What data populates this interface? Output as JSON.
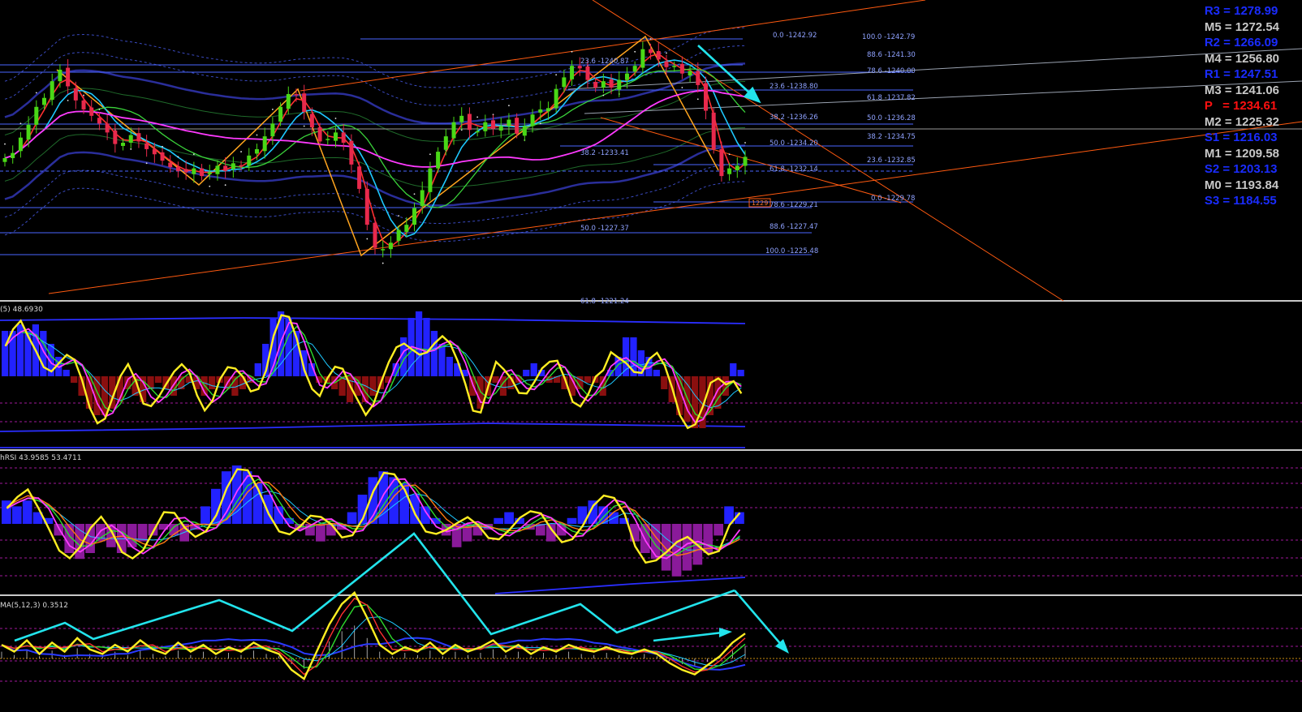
{
  "panes": [
    {
      "id": "price",
      "label": ""
    },
    {
      "id": "osc1",
      "label": "(5) 48.6930"
    },
    {
      "id": "osc2",
      "label": "hRSI 43.9585 53.4711"
    },
    {
      "id": "osc3",
      "label": "MA(5,12,3) 0.3512"
    }
  ],
  "pivots": [
    {
      "text": "R3 = 1278.99",
      "color": "#1a2cff"
    },
    {
      "text": "M5 = 1272.54",
      "color": "#c8c8c8"
    },
    {
      "text": "R2 = 1266.09",
      "color": "#1a2cff"
    },
    {
      "text": "M4 = 1256.80",
      "color": "#c8c8c8"
    },
    {
      "text": "R1 = 1247.51",
      "color": "#1a2cff"
    },
    {
      "text": "M3 = 1241.06",
      "color": "#c8c8c8"
    },
    {
      "text": "P   = 1234.61",
      "color": "#ff1010"
    },
    {
      "text": "M2 = 1225.32",
      "color": "#c8c8c8"
    },
    {
      "text": "S1 = 1216.03",
      "color": "#1a2cff"
    },
    {
      "text": "M1 = 1209.58",
      "color": "#c8c8c8"
    },
    {
      "text": "S2 = 1203.13",
      "color": "#1a2cff"
    },
    {
      "text": "M0 = 1193.84",
      "color": "#c8c8c8"
    },
    {
      "text": "S3 = 1184.55",
      "color": "#1a2cff"
    }
  ],
  "fib_labels": [
    "0.0 -1242.92",
    "100.0 -1242.79",
    "88.6 -1241.30",
    "23.6 -1240.87",
    "78.6 -1240.00",
    "23.6 -1238.80",
    "61.8 -1237.82",
    "38.2 -1236.26",
    "50.0 -1236.28",
    "38.2 -1234.75",
    "50.0 -1234.20",
    "38.2 -1233.41",
    "23.6 -1232.85",
    "61.8 -1232.14",
    "0.0 -1229.78",
    "78.6 -1229.21",
    "50.0 -1227.37",
    "88.6 -1227.47",
    "100.0 -1225.48",
    "61.8 -1221.24"
  ],
  "price_tag": "1229",
  "colors": {
    "up": "#49d816",
    "down": "#e8294c",
    "fib": "#4a66ff",
    "trend": "#ff5a10",
    "arrow": "#22e4ec",
    "signal": "#ffee22",
    "hist_up": "#2222ff",
    "hist_dn": "#8a0f0f",
    "hist_mag": "#8a1a9a"
  },
  "chart_data": [
    {
      "type": "candlestick",
      "title": "",
      "series": [
        {
          "values": [
            1233.6,
            1234.0,
            1235.2,
            1236.2,
            1237.6,
            1238.3,
            1239.6,
            1240.5,
            1239.2,
            1238.1,
            1237.4,
            1236.9,
            1236.3,
            1235.6,
            1234.7,
            1234.8,
            1235.4,
            1234.9,
            1234.3,
            1233.9,
            1233.4,
            1232.9,
            1232.6,
            1232.5,
            1232.8,
            1232.2,
            1232.5,
            1233.0,
            1232.6,
            1233.2,
            1233.0,
            1233.8,
            1234.3,
            1235.3,
            1236.3,
            1237.6,
            1238.6,
            1238.5,
            1237.2,
            1236.0,
            1234.9,
            1235.1,
            1235.6,
            1234.8,
            1233.1,
            1231.2,
            1228.4,
            1226.6,
            1226.5,
            1227.0,
            1228.0,
            1228.4,
            1229.7,
            1231.1,
            1232.8,
            1234.1,
            1235.3,
            1236.4,
            1236.9,
            1235.8,
            1235.7,
            1236.4,
            1235.9,
            1236.1,
            1236.6,
            1235.5,
            1236.1,
            1237.0,
            1237.4,
            1237.5,
            1239.0,
            1239.9,
            1240.8,
            1240.6,
            1239.7,
            1239.1,
            1239.6,
            1239.1,
            1239.7,
            1240.2,
            1240.8,
            1242.1,
            1241.8,
            1241.3,
            1240.7,
            1240.8,
            1240.2,
            1240.4,
            1239.3,
            1237.3,
            1234.3,
            1232.2,
            1232.8,
            1233.0,
            1233.7
          ]
        }
      ]
    },
    {
      "type": "histogram",
      "title": "",
      "series": [
        {
          "values": [
            0.7,
            0.7,
            0.8,
            0.7,
            0.8,
            0.7,
            0.5,
            0.3,
            0.1,
            -0.1,
            -0.3,
            -0.5,
            -0.6,
            -0.6,
            -0.5,
            -0.4,
            -0.2,
            -0.3,
            -0.4,
            -0.2,
            -0.1,
            -0.2,
            -0.3,
            -0.2,
            -0.1,
            -0.2,
            -0.3,
            -0.2,
            -0.1,
            -0.2,
            -0.3,
            -0.2,
            -0.1,
            0.2,
            0.5,
            0.9,
            1.0,
            0.9,
            0.7,
            0.4,
            0.2,
            -0.1,
            -0.1,
            -0.2,
            -0.3,
            -0.4,
            -0.3,
            -0.4,
            -0.3,
            -0.2,
            -0.1,
            0.2,
            0.6,
            0.9,
            1.0,
            0.9,
            0.7,
            0.5,
            0.3,
            0.2,
            0.1,
            -0.3,
            -0.5,
            -0.3,
            -0.1,
            -0.3,
            -0.2,
            -0.1,
            0.1,
            0.2,
            0.1,
            -0.1,
            -0.1,
            -0.2,
            -0.3,
            -0.2,
            -0.1,
            -0.1,
            -0.3,
            0.1,
            0.3,
            0.6,
            0.6,
            0.4,
            0.3,
            0.1,
            -0.2,
            -0.4,
            -0.6,
            -0.7,
            -0.8,
            -0.8,
            -0.6,
            -0.5,
            -0.3,
            0.2,
            0.1
          ]
        }
      ]
    },
    {
      "type": "histogram",
      "title": "",
      "series": [
        {
          "values": [
            0.4,
            0.3,
            0.4,
            0.2,
            0.1,
            -0.2,
            -0.5,
            -0.6,
            -0.5,
            -0.3,
            -0.4,
            -0.5,
            -0.4,
            -0.3,
            -0.2,
            -0.1,
            -0.2,
            -0.3,
            -0.1,
            0.3,
            0.6,
            0.9,
            1.0,
            0.9,
            0.7,
            0.5,
            0.3,
            0.1,
            -0.1,
            -0.2,
            -0.3,
            -0.2,
            -0.1,
            0.2,
            0.5,
            0.8,
            0.9,
            0.8,
            0.7,
            0.5,
            0.3,
            0.1,
            -0.2,
            -0.4,
            -0.3,
            -0.2,
            -0.1,
            0.1,
            0.2,
            0.1,
            -0.1,
            -0.2,
            -0.3,
            -0.2,
            0.1,
            0.3,
            0.4,
            0.3,
            0.2,
            0.1,
            -0.3,
            -0.5,
            -0.6,
            -0.8,
            -0.9,
            -0.8,
            -0.7,
            -0.5,
            -0.2,
            0.3,
            0.2
          ]
        }
      ]
    },
    {
      "type": "line",
      "title": "",
      "series": [
        {
          "values": [
            0.6,
            0.3,
            0.8,
            0.2,
            0.7,
            0.3,
            0.9,
            0.4,
            0.2,
            0.6,
            0.3,
            0.8,
            0.4,
            0.2,
            0.7,
            0.3,
            0.6,
            0.2,
            0.5,
            0.3,
            0.7,
            0.4,
            0.2,
            -0.5,
            -0.9,
            0.3,
            1.5,
            2.4,
            2.9,
            1.8,
            0.6,
            0.2,
            0.5,
            0.3,
            0.7,
            0.2,
            0.6,
            0.3,
            0.5,
            0.8,
            0.3,
            0.6,
            0.2,
            0.5,
            0.3,
            0.6,
            0.4,
            0.3,
            0.5,
            0.3,
            0.2,
            0.4,
            0.2,
            -0.2,
            -0.5,
            -0.7,
            -0.3,
            0.1,
            0.7,
            1.1
          ]
        }
      ]
    }
  ]
}
